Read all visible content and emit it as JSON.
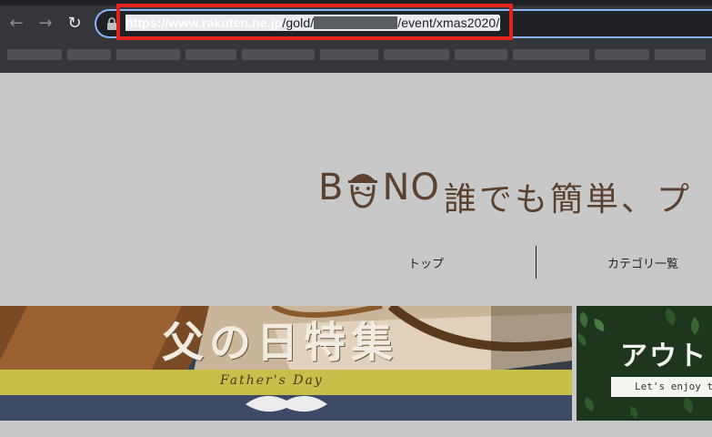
{
  "browser": {
    "url": {
      "prefix": "https://",
      "host": "www.rakuten.ne.jp",
      "path_before": "/gold/",
      "path_after": "/event/xmas2020/"
    },
    "nav": {
      "back": "←",
      "forward": "→",
      "reload": "↻"
    }
  },
  "site": {
    "logo": {
      "b": "B",
      "no": "NO"
    },
    "tagline": "誰でも簡単、プ",
    "nav": [
      {
        "label": "トップ"
      },
      {
        "label": "カテゴリ一覧"
      }
    ]
  },
  "banners": [
    {
      "title": "父の日特集",
      "subtitle": "Father's Day"
    },
    {
      "title": "アウトド",
      "subtitle": "Let's enjoy t"
    }
  ],
  "colors": {
    "highlight": "#e3231c",
    "logo": "#5a4130"
  }
}
